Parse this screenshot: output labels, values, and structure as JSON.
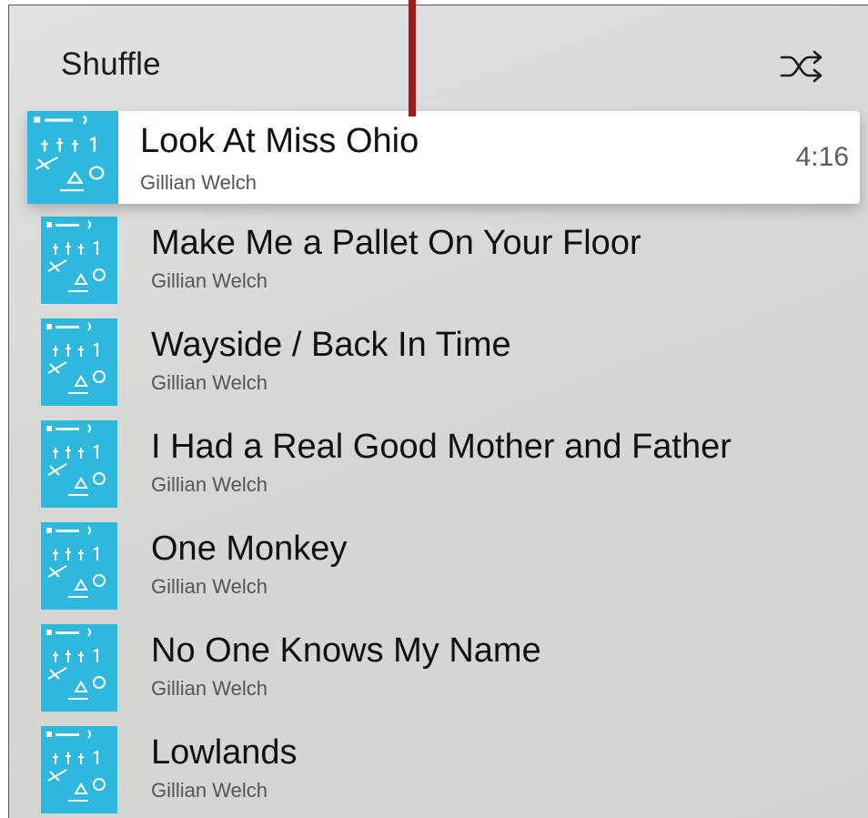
{
  "header": {
    "title": "Shuffle",
    "shuffle_icon": "shuffle-icon"
  },
  "tracks": [
    {
      "title": "Look At Miss Ohio",
      "artist": "Gillian Welch",
      "duration": "4:16",
      "selected": true
    },
    {
      "title": "Make Me a Pallet On Your Floor",
      "artist": "Gillian Welch"
    },
    {
      "title": "Wayside / Back In Time",
      "artist": "Gillian Welch"
    },
    {
      "title": "I Had a Real Good Mother and Father",
      "artist": "Gillian Welch"
    },
    {
      "title": "One Monkey",
      "artist": "Gillian Welch"
    },
    {
      "title": "No One Knows My Name",
      "artist": "Gillian Welch"
    },
    {
      "title": "Lowlands",
      "artist": "Gillian Welch"
    }
  ],
  "colors": {
    "album_art": "#2fb8dd",
    "callout": "#9b1b1f",
    "selected_background": "#ffffff"
  },
  "album_art_icon": "album-cover-icon"
}
